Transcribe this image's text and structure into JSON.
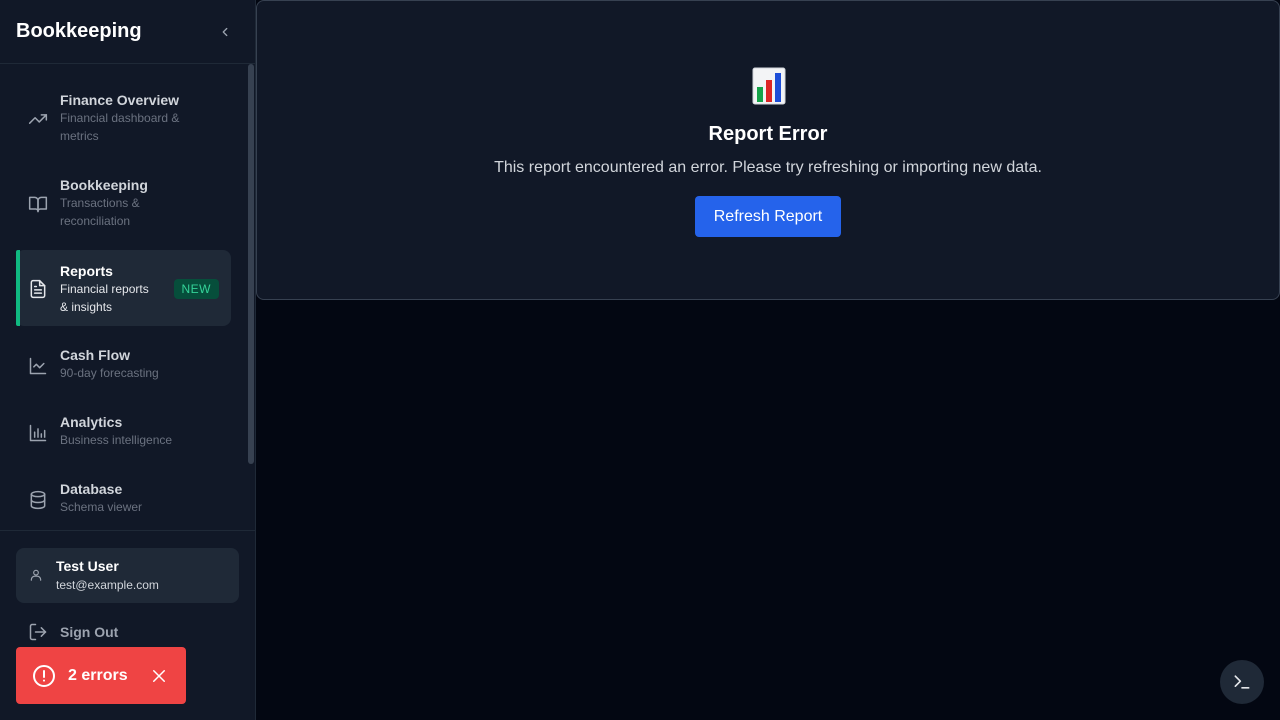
{
  "sidebar": {
    "title": "Bookkeeping",
    "items": [
      {
        "label": "Finance Overview",
        "desc": "Financial dashboard & metrics",
        "icon": "trending-up-icon"
      },
      {
        "label": "Bookkeeping",
        "desc": "Transactions & reconciliation",
        "icon": "book-open-icon"
      },
      {
        "label": "Reports",
        "desc": "Financial reports & insights",
        "icon": "file-text-icon",
        "badge": "NEW",
        "active": true
      },
      {
        "label": "Cash Flow",
        "desc": "90-day forecasting",
        "icon": "line-chart-icon"
      },
      {
        "label": "Analytics",
        "desc": "Business intelligence",
        "icon": "bar-chart-icon"
      },
      {
        "label": "Database",
        "desc": "Schema viewer",
        "icon": "database-icon"
      }
    ],
    "user": {
      "name": "Test User",
      "email": "test@example.com"
    },
    "signout_label": "Sign Out"
  },
  "error_toast": {
    "label": "2 errors"
  },
  "main": {
    "title": "Report Error",
    "message": "This report encountered an error. Please try refreshing or importing new data.",
    "refresh_label": "Refresh Report"
  },
  "colors": {
    "accent": "#10b981",
    "primary_button": "#2563eb",
    "error": "#ef4444",
    "background": "#030712",
    "panel": "#111827"
  }
}
